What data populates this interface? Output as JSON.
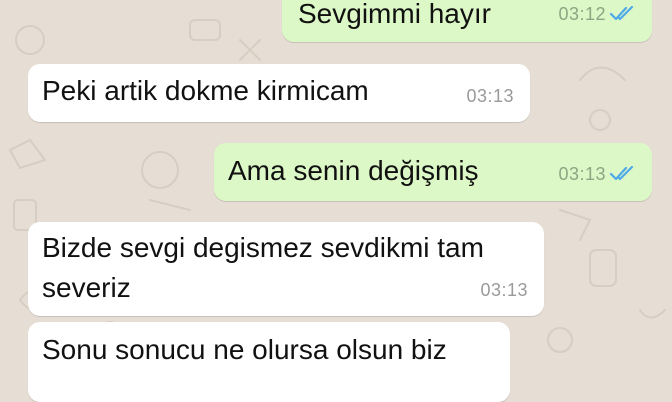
{
  "colors": {
    "wallpaper": "#e6ddd4",
    "incoming_bubble": "#ffffff",
    "outgoing_bubble": "#dcf8c6",
    "read_ticks": "#4fa9e8",
    "timestamp": "#9a9a9a"
  },
  "messages": [
    {
      "direction": "outgoing",
      "text": "Sevgimmi hayır",
      "time": "03:12",
      "status_icon": "double-check-read-icon"
    },
    {
      "direction": "incoming",
      "text": "Peki artik dokme kirmicam",
      "time": "03:13"
    },
    {
      "direction": "outgoing",
      "text": "Ama senin değişmiş",
      "time": "03:13",
      "status_icon": "double-check-read-icon"
    },
    {
      "direction": "incoming",
      "lines": [
        "Bizde sevgi degismez sevdikmi tam",
        "severiz"
      ],
      "time": "03:13"
    },
    {
      "direction": "incoming",
      "lines": [
        "Sonu sonucu ne olursa olsun biz"
      ],
      "time": ""
    }
  ]
}
